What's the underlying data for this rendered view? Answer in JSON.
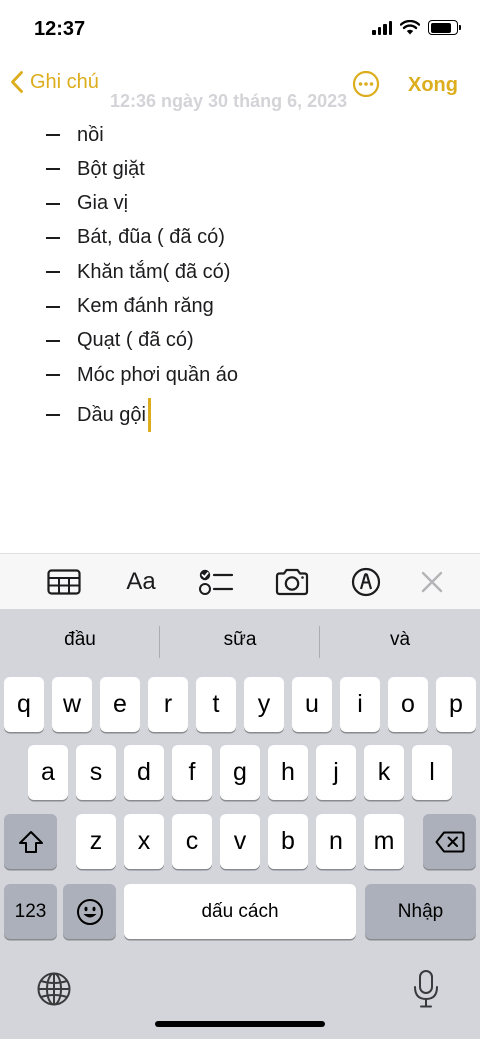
{
  "status_bar": {
    "time": "12:37",
    "icons": [
      "cellular-signal-icon",
      "wifi-icon",
      "battery-icon"
    ]
  },
  "nav": {
    "back_label": "Ghi chú",
    "faded_date": "12:36 ngày 30 tháng 6, 2023",
    "more_icon": "ellipsis-circle-icon",
    "done_label": "Xong"
  },
  "note": {
    "items": [
      "nồi",
      "Bột giặt",
      "Gia vị",
      "Bát, đũa ( đã có)",
      "Khăn tắm( đã có)",
      "Kem đánh răng",
      "Quạt ( đã có)",
      "Móc phơi quần áo",
      "Dầu gội"
    ]
  },
  "format_toolbar": {
    "table_icon": "table-icon",
    "format_label": "Aa",
    "checklist_icon": "checklist-icon",
    "camera_icon": "camera-icon",
    "markup_icon": "markup-pen-icon",
    "close_icon": "close-icon"
  },
  "keyboard": {
    "suggestions": [
      "đầu",
      "sữa",
      "và"
    ],
    "row1": [
      "q",
      "w",
      "e",
      "r",
      "t",
      "y",
      "u",
      "i",
      "o",
      "p"
    ],
    "row2": [
      "a",
      "s",
      "d",
      "f",
      "g",
      "h",
      "j",
      "k",
      "l"
    ],
    "row3": [
      "z",
      "x",
      "c",
      "v",
      "b",
      "n",
      "m"
    ],
    "numbers_label": "123",
    "space_label": "dấu cách",
    "return_label": "Nhập"
  },
  "colors": {
    "accent": "#dcad1c",
    "keyboard_bg": "#d3d5db",
    "key_bg": "#ffffff",
    "special_key_bg": "#abb0ba"
  }
}
